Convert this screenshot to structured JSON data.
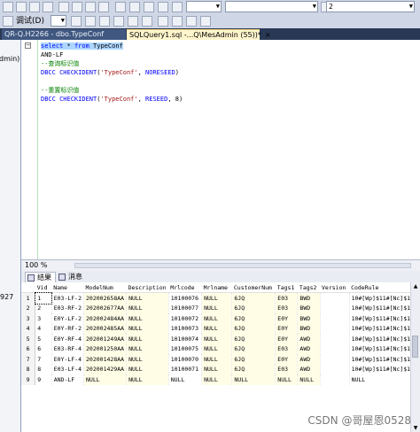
{
  "toolbar": {
    "combo_database": "",
    "combo_right": "2",
    "debug_label": "调试(D)"
  },
  "tabs": [
    {
      "label": "QR-Q.H2266 - dbo.TypeConf",
      "active": false
    },
    {
      "label": "SQLQuery1.sql -...Q\\MesAdmin (55))*",
      "active": true,
      "close": "×"
    }
  ],
  "left_panel": {
    "text1": "dmin)",
    "text2": "927"
  },
  "editor": {
    "lines": [
      [
        {
          "t": "select * from TypeConf",
          "c": "hl"
        }
      ],
      [
        {
          "t": "AND-LF",
          "c": "plain"
        }
      ],
      [
        {
          "t": "--查询标识值",
          "c": "cm"
        }
      ],
      [
        {
          "t": "DBCC CHECKIDENT('TypeConf', NORESEED)",
          "c": "mix1"
        }
      ],
      [
        {
          "t": "",
          "c": "plain"
        }
      ],
      [
        {
          "t": "--重置标识值",
          "c": "cm"
        }
      ],
      [
        {
          "t": "DBCC CHECKIDENT('TypeConf', RESEED, 8)",
          "c": "mix2"
        }
      ]
    ]
  },
  "zoom": "100 %",
  "results_tabs": [
    {
      "label": "结果",
      "active": true
    },
    {
      "label": "消息",
      "active": false
    }
  ],
  "grid": {
    "columns": [
      "Vid",
      "Name",
      "ModelNum",
      "Description",
      "Mrlcode",
      "Mrlname",
      "CustomerNum",
      "Tags1",
      "Tags2",
      "Version",
      "CodeRule"
    ],
    "rows": [
      [
        "1",
        "1",
        "E03-LF-2",
        "202002658AA",
        "NULL",
        "10100076",
        "NULL",
        "6JQ",
        "E03",
        "BWD",
        "",
        "10#[Wp]$11#[Nc]$12#"
      ],
      [
        "2",
        "2",
        "E03-RF-2",
        "202002677AA",
        "NULL",
        "10100077",
        "NULL",
        "6JQ",
        "E03",
        "BWD",
        "",
        "10#[Wp]$11#[Nc]$12#"
      ],
      [
        "3",
        "3",
        "E0Y-LF-2",
        "202002484AA",
        "NULL",
        "10100072",
        "NULL",
        "6JQ",
        "E0Y",
        "BWD",
        "",
        "10#[Wp]$11#[Nc]$12#"
      ],
      [
        "4",
        "4",
        "E0Y-RF-2",
        "202002485AA",
        "NULL",
        "10100073",
        "NULL",
        "6JQ",
        "E0Y",
        "BWD",
        "",
        "10#[Wp]$11#[Nc]$12#"
      ],
      [
        "5",
        "5",
        "E0Y-RF-4",
        "202001249AA",
        "NULL",
        "10100074",
        "NULL",
        "6JQ",
        "E0Y",
        "AWD",
        "",
        "10#[Wp]$11#[Nc]$12#"
      ],
      [
        "6",
        "6",
        "E03-RF-4",
        "202001250AA",
        "NULL",
        "10100075",
        "NULL",
        "6JQ",
        "E03",
        "AWD",
        "",
        "10#[Wp]$11#[Nc]$12#"
      ],
      [
        "7",
        "7",
        "E0Y-LF-4",
        "202001428AA",
        "NULL",
        "10100070",
        "NULL",
        "6JQ",
        "E0Y",
        "AWD",
        "",
        "10#[Wp]$11#[Nc]$12#"
      ],
      [
        "8",
        "8",
        "E03-LF-4",
        "202001429AA",
        "NULL",
        "10100071",
        "NULL",
        "6JQ",
        "E03",
        "AWD",
        "",
        "10#[Wp]$11#[Nc]$12#"
      ],
      [
        "9",
        "9",
        "AND-LF",
        "NULL",
        "NULL",
        "NULL",
        "NULL",
        "NULL",
        "NULL",
        "NULL",
        "",
        "NULL"
      ]
    ]
  },
  "watermark": "CSDN @哥屋恩0528",
  "colors": {
    "tab_bar": "#293955",
    "active_tab": "#fff5cc",
    "keyword": "#0000ff",
    "comment": "#008000",
    "string": "#a31515"
  }
}
